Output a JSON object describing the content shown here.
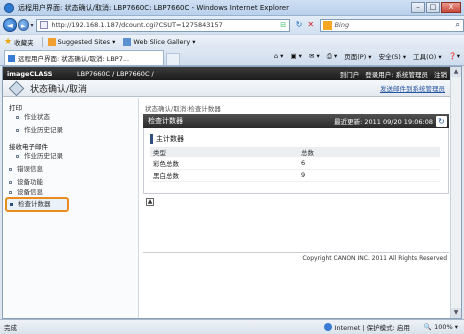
{
  "window": {
    "title": "远程用户界面: 状态确认/取消: LBP7660C: LBP7660C - Windows Internet Explorer",
    "minimize": "–",
    "maximize": "□",
    "close": "X"
  },
  "address": {
    "back": "◄",
    "forward": "►",
    "url": "http://192.168.1.187/dcount.cgi?CSUT=1275843157",
    "search_placeholder": "Bing"
  },
  "favorites": {
    "label": "收藏夹",
    "items": [
      "Suggested Sites ▾",
      "Web Slice Gallery ▾"
    ]
  },
  "tab": {
    "label": "远程用户界面: 状态确认/取消: LBP7..."
  },
  "commands": [
    "页面(P) ▾",
    "安全(S) ▾",
    "工具(O) ▾",
    "❓▾"
  ],
  "topnav": {
    "brand": "imageCLASS",
    "model": "LBP7660C / LBP7660C /",
    "links": [
      "到门户",
      "登录用户: 系统管理员",
      "注销"
    ]
  },
  "header": {
    "title": "状态确认/取消",
    "link": "发送邮件到系统管理员"
  },
  "sidebar": {
    "groups": [
      {
        "label": "打印",
        "items": [
          "作业状态",
          "作业历史记录"
        ]
      },
      {
        "label": "接收电子邮件",
        "items": [
          "作业历史记录"
        ]
      }
    ],
    "top_items": [
      "错误信息",
      "设备功能",
      "设备信息"
    ],
    "selected": "检查计数器"
  },
  "content": {
    "breadcrumb": "状态确认/取消:检查计数器",
    "panel_title": "检查计数器",
    "last_updated": "最近更新: 2011 09/20 19:06:08",
    "section_title": "主计数器",
    "table": {
      "headers": [
        "类型",
        "总数"
      ],
      "rows": [
        {
          "type": "彩色总数",
          "total": "6"
        },
        {
          "type": "黑白总数",
          "total": "9"
        }
      ]
    },
    "footer": "Copyright CANON INC. 2011 All Rights Reserved"
  },
  "status": {
    "left": "完成",
    "zone": "Internet | 保护模式: 启用",
    "zoom": "🔍 100% ▾"
  },
  "colors": {
    "accent_selected": "#e88c20",
    "nav_dark": "#2b2b2b",
    "link": "#2455a4"
  }
}
